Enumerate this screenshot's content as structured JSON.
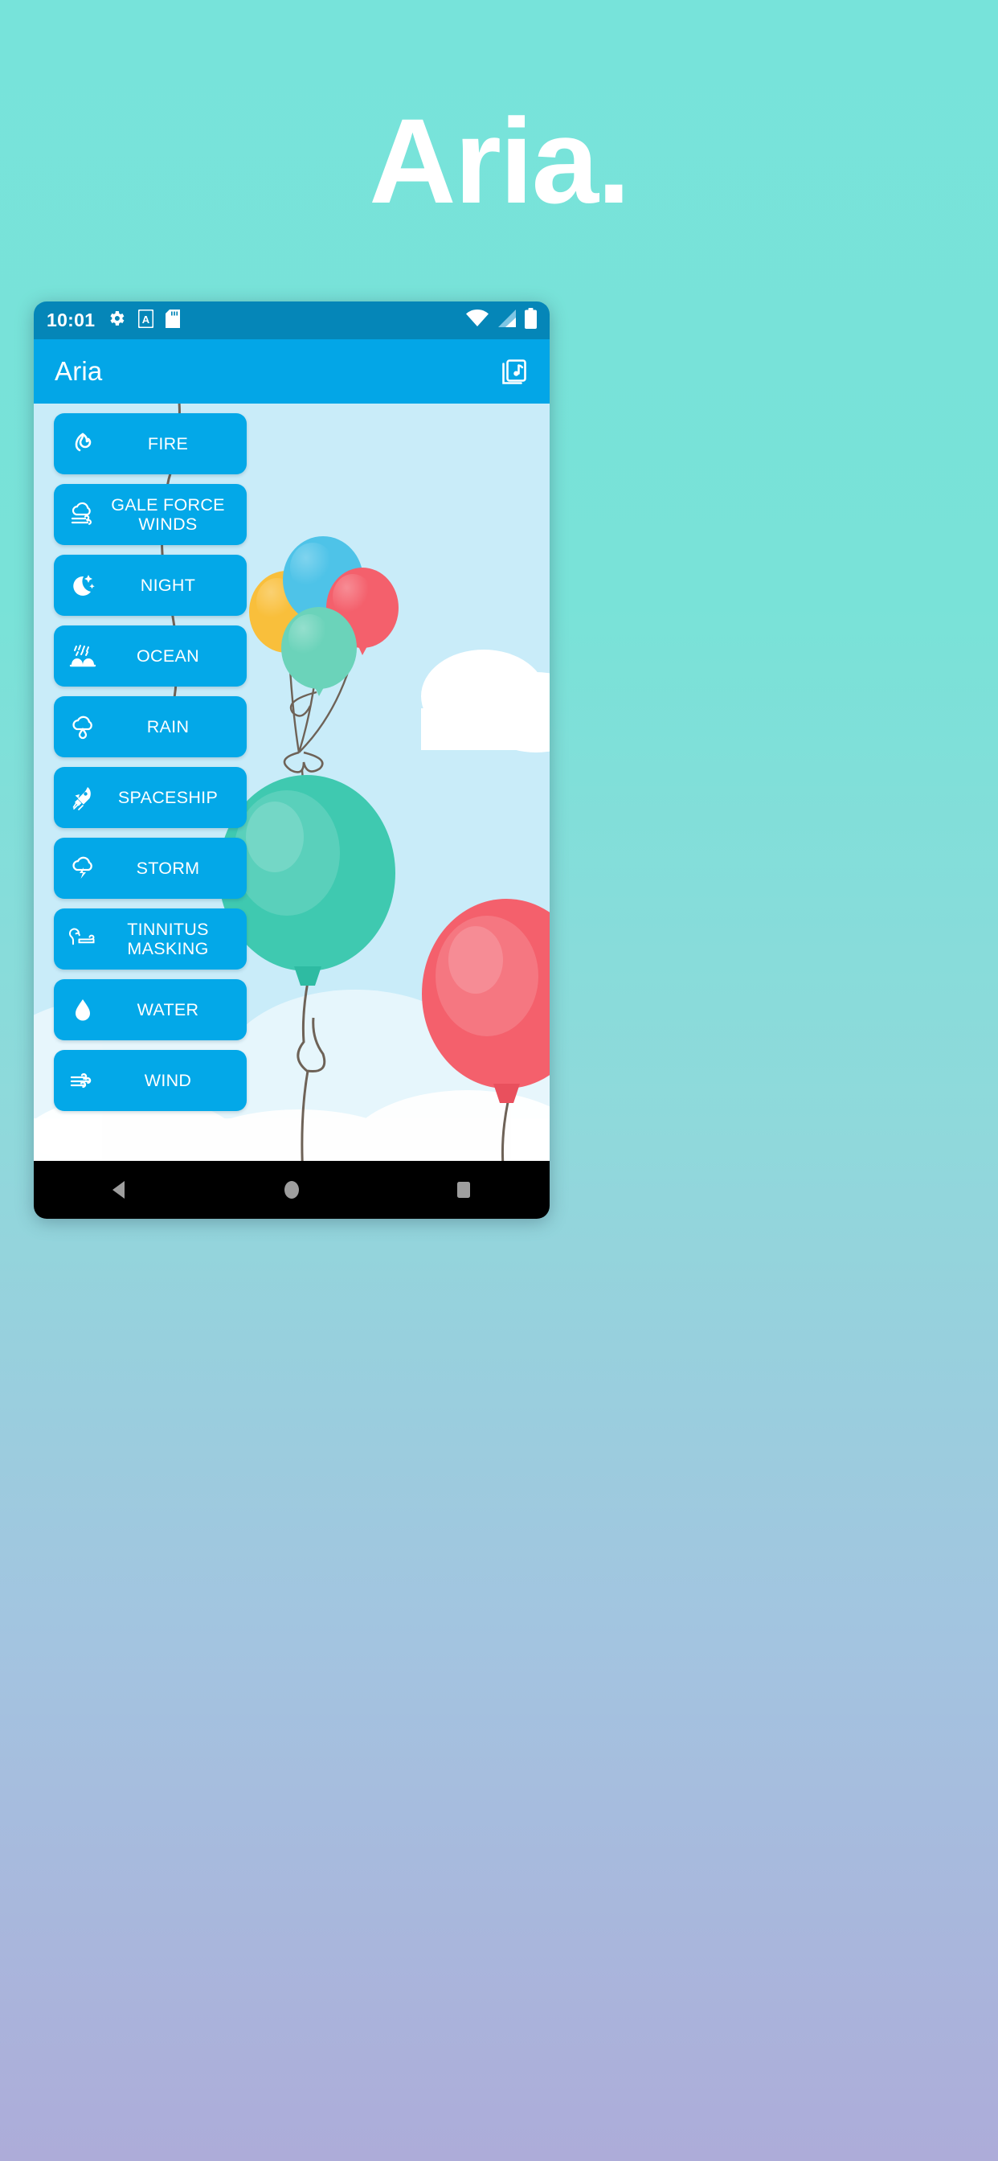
{
  "hero": {
    "title": "Aria."
  },
  "colors": {
    "page_gradient_top": "#77E3DA",
    "page_gradient_bottom": "#ADACD9",
    "status_bar": "#0586B8",
    "app_bar": "#03A6E7",
    "button": "#03A8E8",
    "sky": "#C9ECF9",
    "nav_bar": "#000000",
    "title_text": "#FFFFFF"
  },
  "status_bar": {
    "time": "10:01",
    "left_icons": [
      "gear-icon",
      "a-badge-icon",
      "sd-card-icon"
    ],
    "right_icons": [
      "wifi-icon",
      "cell-signal-icon",
      "battery-icon"
    ]
  },
  "app_bar": {
    "title": "Aria",
    "action_icon": "music-library-icon"
  },
  "sounds": [
    {
      "label": "FIRE",
      "icon": "fire-icon"
    },
    {
      "label": "GALE FORCE WINDS",
      "icon": "cloud-wind-icon"
    },
    {
      "label": "NIGHT",
      "icon": "moon-stars-icon"
    },
    {
      "label": "OCEAN",
      "icon": "rain-waves-icon"
    },
    {
      "label": "RAIN",
      "icon": "cloud-raindrop-icon"
    },
    {
      "label": "SPACESHIP",
      "icon": "rocket-icon"
    },
    {
      "label": "STORM",
      "icon": "cloud-lightning-icon"
    },
    {
      "label": "TINNITUS MASKING",
      "icon": "ear-icon"
    },
    {
      "label": "WATER",
      "icon": "water-drop-icon"
    },
    {
      "label": "WIND",
      "icon": "wind-icon"
    }
  ],
  "background_art": {
    "description": "balloons floating in a blue sky with white clouds",
    "balloon_bunch_colors": [
      "#F7B731",
      "#4EC3E8",
      "#F4606C",
      "#6BD3BA"
    ],
    "large_balloons": [
      {
        "color": "#3FC9B0",
        "name": "teal-balloon"
      },
      {
        "color": "#F4606C",
        "name": "red-balloon"
      }
    ]
  },
  "nav_bar": {
    "back_label": "back-button",
    "home_label": "home-button",
    "recents_label": "recents-button"
  }
}
